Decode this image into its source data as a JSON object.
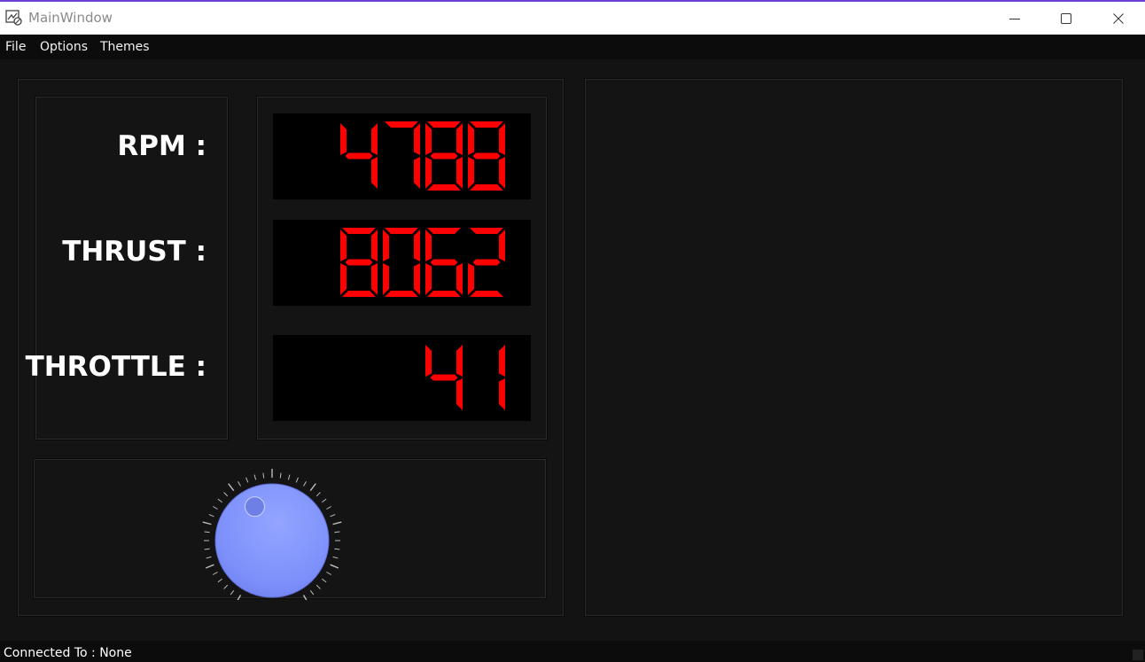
{
  "window": {
    "title": "MainWindow"
  },
  "menu": {
    "items": [
      "File",
      "Options",
      "Themes"
    ]
  },
  "readouts": [
    {
      "label": "RPM :",
      "value": "4788"
    },
    {
      "label": "THRUST :",
      "value": "8062"
    },
    {
      "label": "THROTTLE :",
      "value": "41"
    }
  ],
  "dial": {
    "value_fraction": 0.41
  },
  "status": {
    "text": "Connected To : None"
  },
  "colors": {
    "lcd_on": "#ff0000",
    "lcd_background": "#000000",
    "knob": "#7f93ff",
    "title_accent": "#6b3fd6"
  },
  "icons": {
    "app": "app-logo-icon",
    "minimize": "minimize-icon",
    "maximize": "maximize-icon",
    "close": "close-icon"
  }
}
